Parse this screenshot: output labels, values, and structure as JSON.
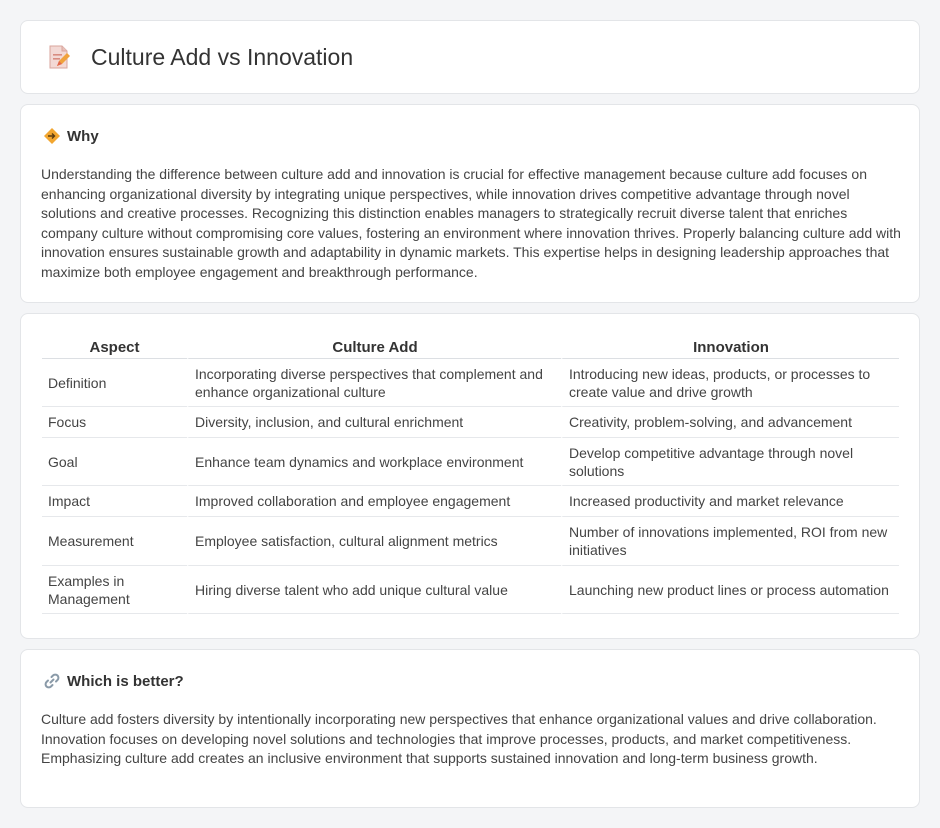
{
  "header": {
    "title": "Culture Add vs Innovation",
    "icon": "document-pencil-icon"
  },
  "why": {
    "title": "Why",
    "icon": "diamond-arrows-icon",
    "text": "Understanding the difference between culture add and innovation is crucial for effective management because culture add focuses on enhancing organizational diversity by integrating unique perspectives, while innovation drives competitive advantage through novel solutions and creative processes. Recognizing this distinction enables managers to strategically recruit diverse talent that enriches company culture without compromising core values, fostering an environment where innovation thrives. Properly balancing culture add with innovation ensures sustainable growth and adaptability in dynamic markets. This expertise helps in designing leadership approaches that maximize both employee engagement and breakthrough performance."
  },
  "table": {
    "headers": [
      "Aspect",
      "Culture Add",
      "Innovation"
    ],
    "rows": [
      [
        "Definition",
        "Incorporating diverse perspectives that complement and enhance organizational culture",
        "Introducing new ideas, products, or processes to create value and drive growth"
      ],
      [
        "Focus",
        "Diversity, inclusion, and cultural enrichment",
        "Creativity, problem-solving, and advancement"
      ],
      [
        "Goal",
        "Enhance team dynamics and workplace environment",
        "Develop competitive advantage through novel solutions"
      ],
      [
        "Impact",
        "Improved collaboration and employee engagement",
        "Increased productivity and market relevance"
      ],
      [
        "Measurement",
        "Employee satisfaction, cultural alignment metrics",
        "Number of innovations implemented, ROI from new initiatives"
      ],
      [
        "Examples in Management",
        "Hiring diverse talent who add unique cultural value",
        "Launching new product lines or process automation"
      ]
    ]
  },
  "better": {
    "title": "Which is better?",
    "icon": "link-icon",
    "text": "Culture add fosters diversity by intentionally incorporating new perspectives that enhance organizational values and drive collaboration. Innovation focuses on developing novel solutions and technologies that improve processes, products, and market competitiveness. Emphasizing culture add creates an inclusive environment that supports sustained innovation and long-term business growth."
  }
}
